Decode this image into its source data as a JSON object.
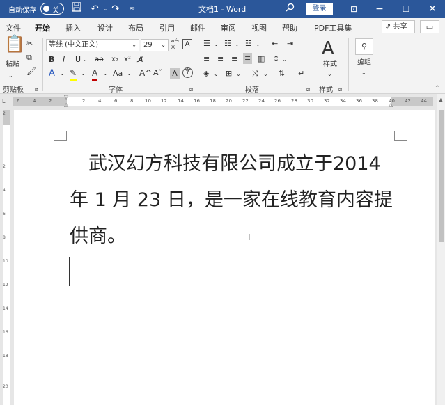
{
  "titlebar": {
    "autosave_label": "自动保存",
    "autosave_state": "关",
    "doc_title": "文档1  -  Word",
    "login_label": "登录",
    "icons": [
      "save-icon",
      "undo-icon",
      "redo-icon",
      "customize-icon",
      "search-icon",
      "ribbon-display-icon",
      "minimize-icon",
      "maximize-icon",
      "close-icon"
    ]
  },
  "tabs": [
    {
      "label": "文件"
    },
    {
      "label": "开始",
      "active": true
    },
    {
      "label": "插入"
    },
    {
      "label": "设计"
    },
    {
      "label": "布局"
    },
    {
      "label": "引用"
    },
    {
      "label": "邮件"
    },
    {
      "label": "审阅"
    },
    {
      "label": "视图"
    },
    {
      "label": "帮助"
    },
    {
      "label": "PDF工具集"
    }
  ],
  "share_label": "共享",
  "ribbon": {
    "clipboard": {
      "paste_label": "粘贴",
      "group_label": "剪贴板"
    },
    "font": {
      "font_name": "等线 (中文正文)",
      "font_size": "29",
      "group_label": "字体",
      "wen_label": "wén\n文"
    },
    "paragraph": {
      "group_label": "段落"
    },
    "styles": {
      "label": "样式",
      "group_label": "样式"
    },
    "editing": {
      "label": "编辑"
    }
  },
  "ruler": {
    "left_numbers": [
      "6",
      "4",
      "2"
    ],
    "right_numbers": [
      "2",
      "4",
      "6",
      "8",
      "10",
      "12",
      "14",
      "16",
      "18",
      "20",
      "22",
      "24",
      "26",
      "28",
      "30",
      "32",
      "34",
      "36",
      "38",
      "40",
      "42",
      "44"
    ],
    "v_numbers": [
      "2",
      "2",
      "4",
      "6",
      "8",
      "10",
      "12",
      "14",
      "16",
      "18",
      "20"
    ]
  },
  "document": {
    "paragraph": "　武汉幻方科技有限公司成立于2014 年 1 月 23 日，是一家在线教育内容提供商。"
  },
  "colors": {
    "title_bar": "#2b579a",
    "ribbon_bg": "#f3f3f3",
    "page_bg": "#ffffff"
  }
}
